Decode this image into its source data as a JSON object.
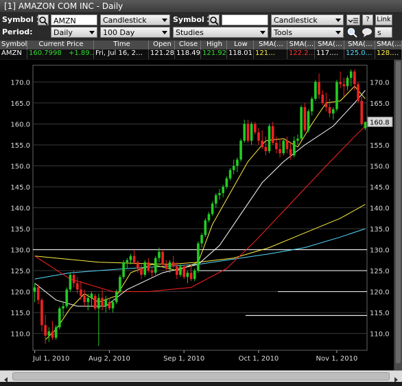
{
  "window": {
    "title": "[1] AMAZON COM INC - Daily"
  },
  "toolbar": {
    "symbol1_label": "Symbol 1:",
    "symbol1_value": "AMZN",
    "chart_type": "Candlestick",
    "symbol2_label": "Symbol 2:",
    "symbol2_value": "",
    "chart_type2": "Candlestick",
    "help_label": "?",
    "link_label": "Link",
    "period_label": "Period:",
    "period_value": "Daily",
    "range_value": "100 Day",
    "studies_label": "Studies",
    "tools_label": "Tools",
    "s_label": "s"
  },
  "quote": {
    "headers": [
      "Symbol",
      "Current Price",
      "Time",
      "Open",
      "Close",
      "High",
      "Low",
      "SMA(…",
      "SMA(…",
      "SMA(…",
      "SMA(…",
      "SMA(…"
    ],
    "values": [
      "AMZN",
      "160.7998",
      "+1.89…",
      "Fri, Jul 16, 2…",
      "121.28",
      "118.49",
      "121.92",
      "118.01",
      "121…",
      "122.2…",
      "117.…",
      "125.0…",
      "128.…"
    ],
    "colors": {
      "price": "#33dd33",
      "high": "#33dd33",
      "sma1": "#ffee44",
      "sma2": "#ff3333",
      "sma3": "#ffffff",
      "sma4": "#55ddff",
      "sma5": "#ffee44"
    }
  },
  "chart_data": {
    "type": "candlestick",
    "ylim": [
      106,
      174
    ],
    "yticks": [
      110.0,
      115.0,
      120.0,
      125.0,
      130.0,
      135.0,
      140.0,
      145.0,
      150.0,
      155.0,
      160.0,
      165.0,
      170.0
    ],
    "xtick_labels": [
      "Jul 1, 2010",
      "Aug 2, 2010",
      "Sep 1, 2010",
      "Oct 1, 2010",
      "Nov 1, 2010"
    ],
    "xtick_index": [
      0,
      21,
      42,
      63,
      85
    ],
    "last_price_label": "160.8",
    "horizontal_lines": [
      130.0,
      125.0,
      120.0,
      114.3
    ],
    "candles": [
      [
        120.0,
        122.0,
        117.5,
        121.0
      ],
      [
        121.0,
        121.8,
        117.0,
        118.0
      ],
      [
        118.0,
        118.5,
        110.5,
        112.0
      ],
      [
        112.0,
        114.5,
        107.5,
        109.5
      ],
      [
        109.5,
        111.5,
        108.0,
        110.5
      ],
      [
        110.5,
        113.0,
        108.5,
        109.0
      ],
      [
        109.0,
        112.0,
        108.5,
        111.5
      ],
      [
        111.5,
        116.5,
        111.0,
        116.0
      ],
      [
        116.0,
        117.5,
        114.0,
        116.5
      ],
      [
        116.5,
        121.0,
        116.0,
        120.5
      ],
      [
        120.5,
        124.5,
        120.0,
        124.0
      ],
      [
        124.0,
        125.0,
        121.0,
        122.0
      ],
      [
        122.0,
        123.5,
        119.5,
        120.5
      ],
      [
        120.5,
        122.5,
        118.0,
        119.0
      ],
      [
        119.0,
        120.5,
        116.5,
        117.5
      ],
      [
        117.5,
        119.5,
        115.5,
        118.5
      ],
      [
        118.5,
        120.0,
        116.5,
        119.5
      ],
      [
        119.0,
        119.5,
        115.5,
        116.0
      ],
      [
        116.0,
        119.5,
        107.0,
        118.5
      ],
      [
        118.5,
        120.5,
        115.5,
        116.5
      ],
      [
        116.5,
        119.0,
        115.0,
        118.0
      ],
      [
        117.5,
        118.5,
        115.5,
        116.0
      ],
      [
        116.0,
        118.0,
        115.0,
        117.5
      ],
      [
        117.5,
        120.5,
        117.0,
        120.0
      ],
      [
        120.0,
        124.0,
        119.5,
        123.5
      ],
      [
        123.5,
        127.5,
        123.0,
        127.0
      ],
      [
        127.0,
        128.0,
        125.5,
        127.5
      ],
      [
        127.5,
        129.0,
        126.5,
        128.5
      ],
      [
        128.5,
        130.0,
        126.5,
        127.0
      ],
      [
        127.0,
        127.5,
        124.5,
        125.5
      ],
      [
        125.5,
        126.5,
        123.0,
        124.0
      ],
      [
        124.0,
        127.5,
        123.5,
        127.0
      ],
      [
        127.0,
        128.0,
        124.5,
        125.0
      ],
      [
        125.0,
        126.0,
        123.5,
        124.5
      ],
      [
        124.5,
        128.5,
        124.0,
        128.0
      ],
      [
        128.0,
        130.5,
        127.0,
        129.5
      ],
      [
        129.5,
        130.0,
        126.0,
        126.5
      ],
      [
        126.5,
        127.5,
        125.0,
        125.5
      ],
      [
        125.5,
        127.5,
        124.5,
        127.0
      ],
      [
        127.0,
        128.5,
        125.5,
        126.0
      ],
      [
        126.0,
        127.0,
        123.0,
        124.0
      ],
      [
        124.0,
        126.5,
        123.5,
        126.0
      ],
      [
        126.0,
        126.5,
        123.0,
        123.5
      ],
      [
        123.5,
        125.0,
        122.0,
        124.5
      ],
      [
        124.5,
        126.5,
        122.5,
        123.0
      ],
      [
        123.0,
        125.5,
        122.5,
        125.0
      ],
      [
        125.0,
        132.0,
        124.5,
        131.5
      ],
      [
        131.5,
        134.0,
        130.5,
        133.5
      ],
      [
        133.5,
        137.5,
        133.0,
        137.0
      ],
      [
        137.0,
        139.0,
        136.5,
        138.5
      ],
      [
        138.5,
        141.5,
        138.0,
        141.0
      ],
      [
        141.0,
        143.5,
        140.0,
        143.0
      ],
      [
        143.0,
        144.5,
        142.0,
        143.5
      ],
      [
        143.5,
        145.5,
        142.5,
        145.0
      ],
      [
        145.0,
        147.5,
        144.5,
        147.0
      ],
      [
        147.0,
        149.5,
        146.5,
        149.0
      ],
      [
        149.0,
        151.5,
        148.0,
        150.0
      ],
      [
        150.0,
        152.0,
        148.5,
        151.5
      ],
      [
        151.5,
        156.5,
        151.0,
        156.0
      ],
      [
        156.0,
        161.0,
        155.5,
        160.0
      ],
      [
        160.0,
        161.0,
        155.5,
        156.0
      ],
      [
        156.0,
        160.5,
        155.0,
        160.0
      ],
      [
        160.0,
        160.5,
        157.5,
        158.0
      ],
      [
        158.0,
        159.0,
        155.0,
        156.0
      ],
      [
        156.0,
        158.5,
        154.0,
        154.5
      ],
      [
        154.5,
        157.0,
        152.5,
        153.5
      ],
      [
        153.5,
        160.0,
        153.0,
        159.5
      ],
      [
        159.5,
        160.5,
        155.0,
        155.5
      ],
      [
        155.5,
        157.0,
        153.0,
        154.0
      ],
      [
        154.0,
        156.5,
        152.0,
        153.0
      ],
      [
        153.0,
        156.5,
        152.5,
        156.0
      ],
      [
        156.0,
        157.0,
        153.0,
        154.0
      ],
      [
        154.0,
        155.5,
        151.5,
        152.5
      ],
      [
        152.5,
        157.0,
        152.0,
        156.0
      ],
      [
        156.0,
        157.5,
        155.0,
        156.5
      ],
      [
        156.5,
        164.5,
        156.0,
        164.0
      ],
      [
        164.0,
        165.0,
        158.0,
        158.5
      ],
      [
        158.5,
        163.5,
        158.0,
        163.0
      ],
      [
        163.0,
        166.5,
        162.0,
        166.0
      ],
      [
        166.0,
        170.5,
        165.5,
        170.0
      ],
      [
        170.0,
        172.0,
        166.0,
        167.0
      ],
      [
        167.0,
        168.0,
        164.5,
        165.0
      ],
      [
        165.0,
        167.5,
        163.0,
        164.0
      ],
      [
        164.0,
        166.0,
        161.5,
        162.5
      ],
      [
        162.5,
        164.0,
        161.0,
        163.5
      ],
      [
        163.5,
        170.5,
        163.0,
        170.0
      ],
      [
        170.0,
        172.5,
        168.5,
        169.5
      ],
      [
        169.5,
        171.0,
        166.5,
        169.0
      ],
      [
        169.0,
        171.5,
        168.0,
        171.0
      ],
      [
        171.0,
        173.0,
        169.0,
        172.5
      ],
      [
        172.5,
        173.0,
        168.0,
        169.5
      ],
      [
        169.5,
        170.0,
        165.0,
        165.5
      ],
      [
        165.5,
        166.5,
        159.5,
        160.0
      ],
      [
        159.0,
        160.5,
        158.5,
        160.5
      ]
    ],
    "sma_series": [
      {
        "color": "#ffee44",
        "points": [
          [
            0,
            128.5
          ],
          [
            18,
            127.0
          ],
          [
            38,
            126.5
          ],
          [
            46,
            127.0
          ],
          [
            56,
            128.0
          ],
          [
            66,
            130.5
          ],
          [
            76,
            134.0
          ],
          [
            86,
            137.5
          ],
          [
            93,
            140.8
          ]
        ]
      },
      {
        "color": "#55ddff",
        "points": [
          [
            0,
            123.0
          ],
          [
            10,
            124.5
          ],
          [
            26,
            125.5
          ],
          [
            46,
            126.5
          ],
          [
            66,
            129.0
          ],
          [
            76,
            130.5
          ],
          [
            86,
            133.0
          ],
          [
            93,
            135.0
          ]
        ]
      },
      {
        "color": "#ff2222",
        "points": [
          [
            0,
            128.5
          ],
          [
            10,
            123.0
          ],
          [
            22,
            120.0
          ],
          [
            32,
            120.0
          ],
          [
            44,
            121.0
          ],
          [
            54,
            125.5
          ],
          [
            62,
            132.0
          ],
          [
            72,
            141.0
          ],
          [
            82,
            150.0
          ],
          [
            90,
            157.0
          ],
          [
            93,
            159.5
          ]
        ]
      },
      {
        "color": "#ffffff",
        "points": [
          [
            0,
            122.0
          ],
          [
            6,
            118.0
          ],
          [
            12,
            116.5
          ],
          [
            20,
            116.5
          ],
          [
            26,
            120.5
          ],
          [
            36,
            124.5
          ],
          [
            46,
            126.5
          ],
          [
            52,
            131.0
          ],
          [
            58,
            138.5
          ],
          [
            64,
            146.0
          ],
          [
            70,
            151.0
          ],
          [
            76,
            155.0
          ],
          [
            84,
            159.5
          ],
          [
            90,
            165.0
          ],
          [
            93,
            168.0
          ]
        ]
      },
      {
        "color": "#ffee44",
        "points": [
          [
            3,
            108.5
          ],
          [
            6,
            111.0
          ],
          [
            10,
            116.0
          ],
          [
            14,
            119.5
          ],
          [
            18,
            117.5
          ],
          [
            23,
            119.0
          ],
          [
            27,
            124.5
          ],
          [
            33,
            126.5
          ],
          [
            40,
            125.0
          ],
          [
            46,
            127.0
          ],
          [
            50,
            136.0
          ],
          [
            55,
            143.5
          ],
          [
            60,
            151.0
          ],
          [
            65,
            156.0
          ],
          [
            70,
            156.5
          ],
          [
            74,
            154.5
          ],
          [
            78,
            160.0
          ],
          [
            82,
            165.0
          ],
          [
            86,
            165.5
          ],
          [
            90,
            169.0
          ],
          [
            93,
            166.0
          ]
        ]
      }
    ]
  }
}
